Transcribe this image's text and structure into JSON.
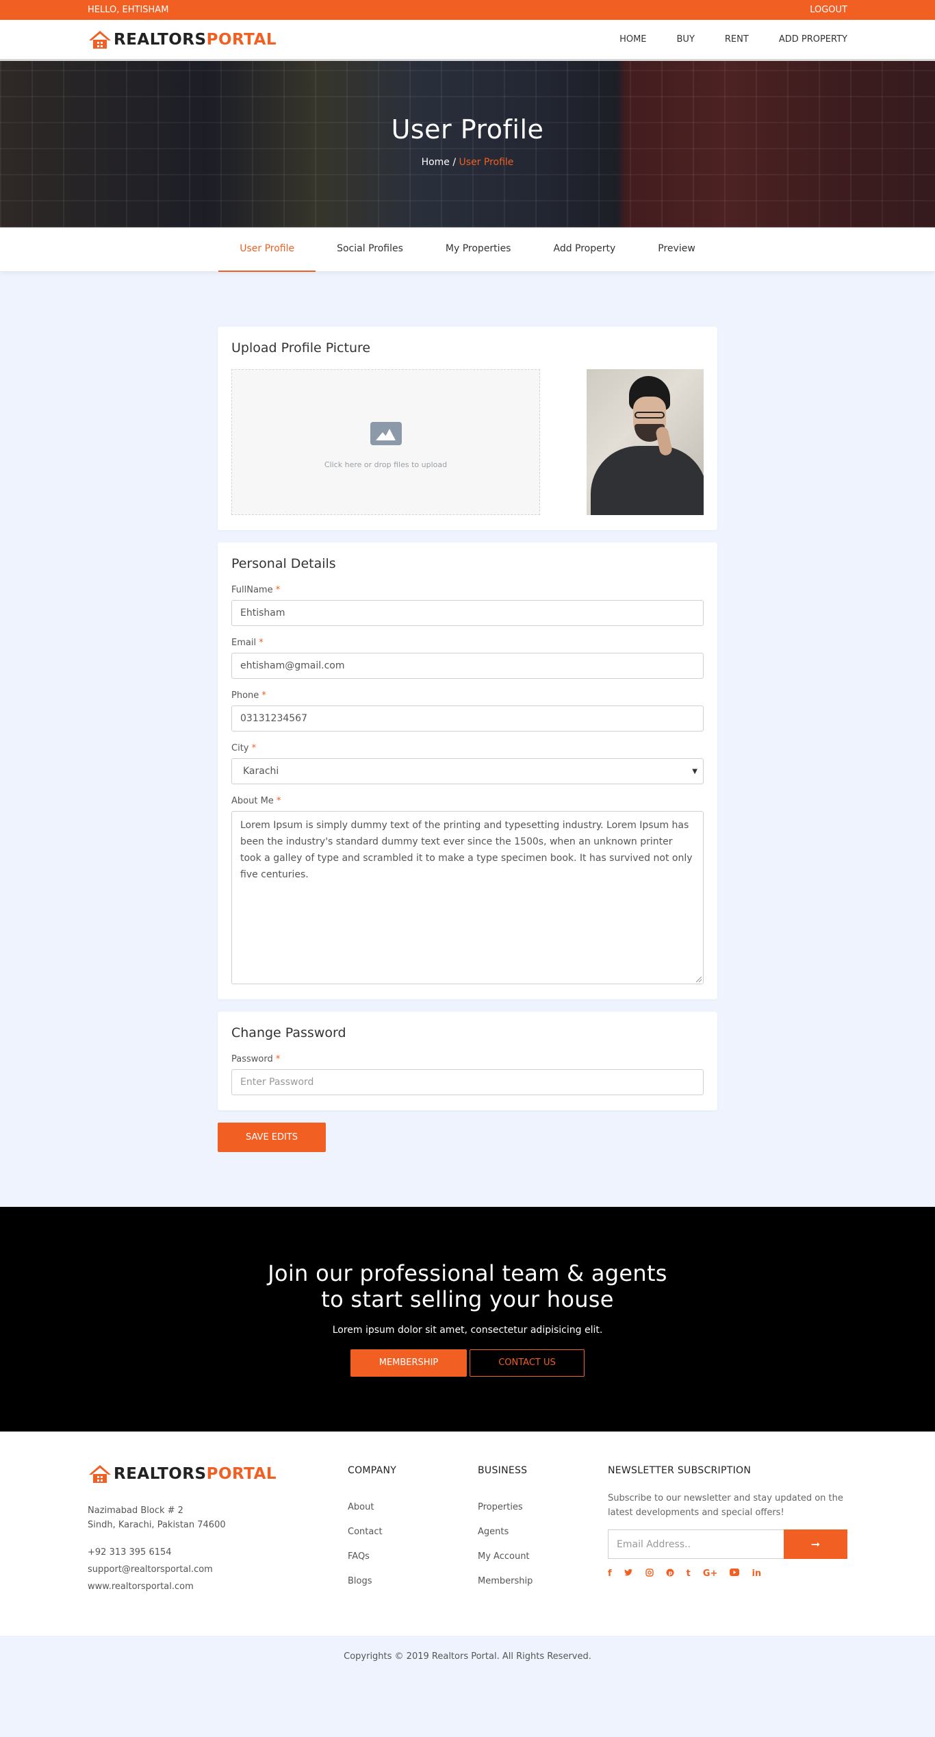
{
  "topbar": {
    "greeting": "HELLO, EHTISHAM",
    "logout": "LOGOUT"
  },
  "brand": {
    "part1": "REALTORS",
    "part2": "PORTAL",
    "accent": "#f15f22"
  },
  "nav": {
    "items": [
      "HOME",
      "BUY",
      "RENT",
      "ADD PROPERTY"
    ]
  },
  "hero": {
    "title": "User Profile",
    "crumb_home": "Home",
    "crumb_sep": " / ",
    "crumb_current": "User Profile"
  },
  "tabs": [
    "User Profile",
    "Social Profiles",
    "My Properties",
    "Add Property",
    "Preview"
  ],
  "upload": {
    "title": "Upload Profile Picture",
    "hint": "Click here or drop files to upload"
  },
  "personal": {
    "title": "Personal Details",
    "fullname_label": "FullName",
    "fullname_value": "Ehtisham",
    "email_label": "Email",
    "email_value": "ehtisham@gmail.com",
    "phone_label": "Phone",
    "phone_value": "03131234567",
    "city_label": "City",
    "city_value": "Karachi",
    "about_label": "About Me",
    "about_value": "Lorem Ipsum is simply dummy text of the printing and typesetting industry. Lorem Ipsum has been the industry's standard dummy text ever since the 1500s, when an unknown printer took a galley of type and scrambled it to make a type specimen book. It has survived not only five centuries.",
    "required_mark": "*"
  },
  "password": {
    "title": "Change Password",
    "label": "Password",
    "placeholder": "Enter Password"
  },
  "save_label": "SAVE EDITS",
  "cta": {
    "line1": "Join our professional team & agents",
    "line2": "to start selling your house",
    "sub": "Lorem ipsum dolor sit amet, consectetur adipisicing elit.",
    "btn1": "MEMBERSHIP",
    "btn2": "CONTACT US"
  },
  "footer": {
    "addr1": "Nazimabad Block # 2",
    "addr2": "Sindh, Karachi, Pakistan 74600",
    "phone": "+92 313 395 6154",
    "email": "support@realtorsportal.com",
    "web": "www.realtorsportal.com",
    "company_title": "COMPANY",
    "company_links": [
      "About",
      "Contact",
      "FAQs",
      "Blogs"
    ],
    "business_title": "BUSINESS",
    "business_links": [
      "Properties",
      "Agents",
      "My Account",
      "Membership"
    ],
    "news_title": "NEWSLETTER SUBSCRIPTION",
    "news_text": "Subscribe to our newsletter and stay updated on the latest developments and special offers!",
    "news_placeholder": "Email Address..",
    "social_icons": [
      "facebook-icon",
      "twitter-icon",
      "instagram-icon",
      "pinterest-icon",
      "tumblr-icon",
      "google-plus-icon",
      "youtube-icon",
      "linkedin-icon"
    ],
    "copyright": "Copyrights © 2019 Realtors Portal. All Rights Reserved."
  }
}
